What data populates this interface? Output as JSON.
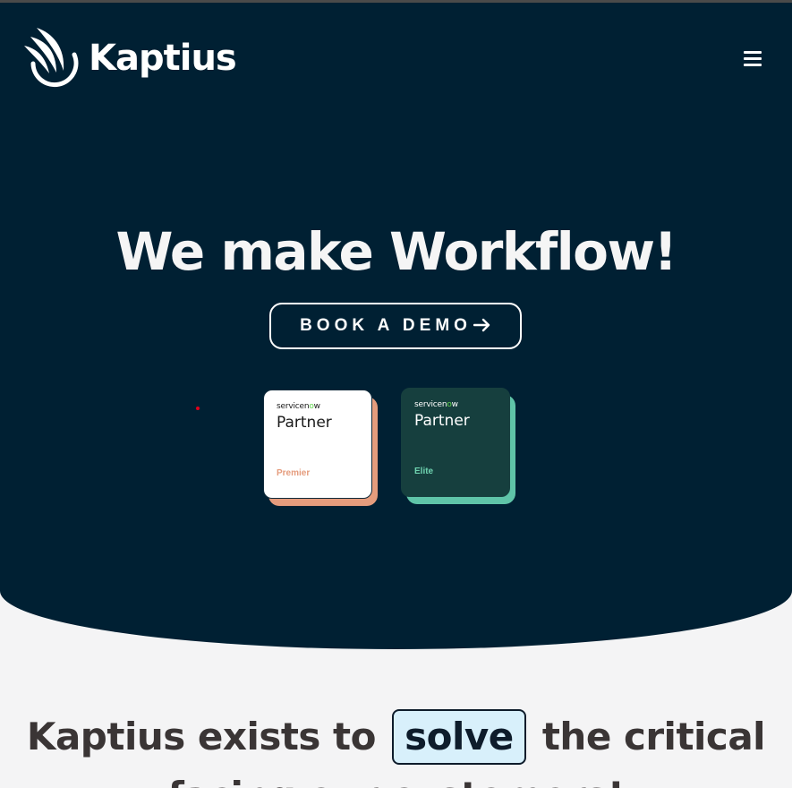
{
  "header": {
    "brand_name": "Kaptius",
    "menu_icon": "hamburger-menu-icon"
  },
  "hero": {
    "title": "We make Workflow!",
    "cta_label": "BOOK A DEMO",
    "cta_icon": "arrow-right-icon",
    "badges": [
      {
        "brand": "servicenow",
        "title": "Partner",
        "tier": "Premier"
      },
      {
        "brand": "servicenow",
        "title": "Partner",
        "tier": "Elite"
      }
    ]
  },
  "mission": {
    "before": "Kaptius exists to",
    "highlight": "solve",
    "after": "the critical",
    "line2": "facing our customers!"
  },
  "colors": {
    "hero_bg": "#002033",
    "page_bg": "#f4f4f5",
    "premier_accent": "#e59c7d",
    "elite_accent": "#5fc4a8",
    "highlight_bg": "#d8f0fb"
  }
}
